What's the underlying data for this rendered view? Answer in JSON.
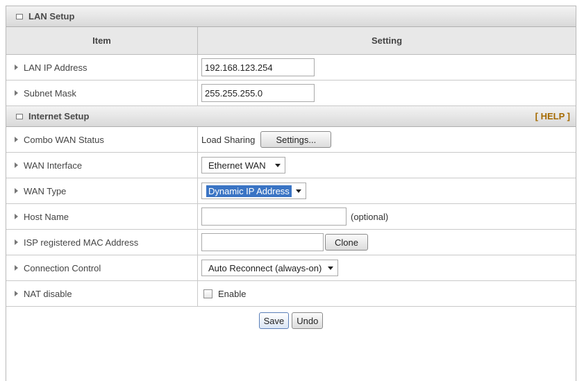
{
  "lan_section": {
    "title": "LAN Setup",
    "col_item": "Item",
    "col_setting": "Setting",
    "rows": [
      {
        "label": "LAN IP Address",
        "value": "192.168.123.254"
      },
      {
        "label": "Subnet Mask",
        "value": "255.255.255.0"
      }
    ]
  },
  "internet_section": {
    "title": "Internet Setup",
    "help": "[ HELP ]",
    "combo_wan": {
      "label": "Combo WAN Status",
      "status": "Load Sharing",
      "button": "Settings..."
    },
    "wan_interface": {
      "label": "WAN Interface",
      "selected": "Ethernet WAN"
    },
    "wan_type": {
      "label": "WAN Type",
      "selected": "Dynamic IP Address"
    },
    "host_name": {
      "label": "Host Name",
      "value": "",
      "hint": "(optional)"
    },
    "mac_address": {
      "label": "ISP registered MAC Address",
      "value": "",
      "button": "Clone"
    },
    "connection_control": {
      "label": "Connection Control",
      "selected": "Auto Reconnect (always-on)"
    },
    "nat_disable": {
      "label": "NAT disable",
      "checkbox_label": "Enable",
      "checked": false
    }
  },
  "footer": {
    "save": "Save",
    "undo": "Undo"
  },
  "colors": {
    "select_highlight": "#3a74c4",
    "help_link": "#a56a00"
  }
}
